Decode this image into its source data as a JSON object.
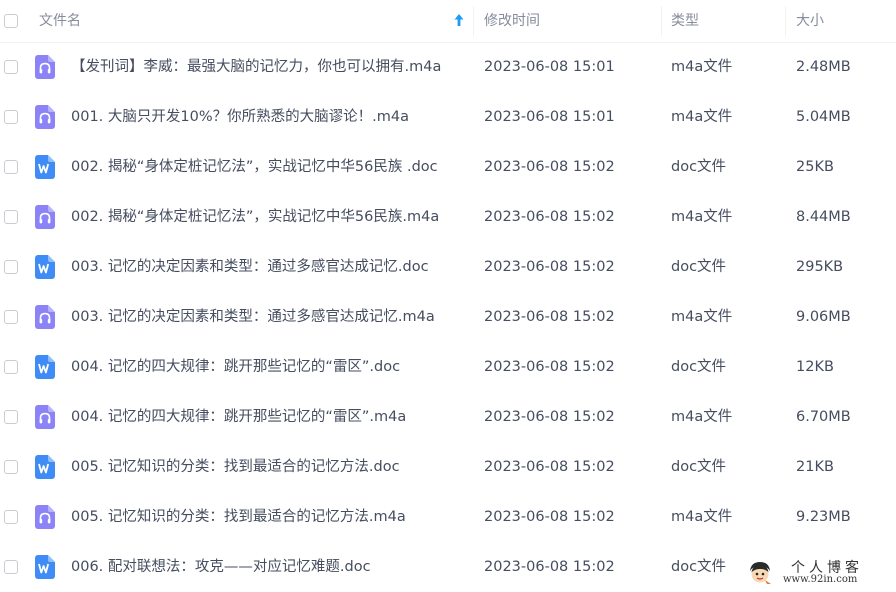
{
  "header": {
    "name_label": "文件名",
    "time_label": "修改时间",
    "type_label": "类型",
    "size_label": "大小"
  },
  "colors": {
    "audio_icon": "#8c83f6",
    "doc_icon": "#3f8cf6",
    "sort_arrow": "#1e9bf5"
  },
  "files": [
    {
      "name": "【发刊词】李威：最强大脑的记忆力，你也可以拥有.m4a",
      "time": "2023-06-08 15:01",
      "type": "m4a文件",
      "size": "2.48MB",
      "icon": "audio-file-icon"
    },
    {
      "name": "001. 大脑只开发10%？你所熟悉的大脑谬论！.m4a",
      "time": "2023-06-08 15:01",
      "type": "m4a文件",
      "size": "5.04MB",
      "icon": "audio-file-icon"
    },
    {
      "name": "002. 揭秘“身体定桩记忆法”，实战记忆中华56民族 .doc",
      "time": "2023-06-08 15:02",
      "type": "doc文件",
      "size": "25KB",
      "icon": "word-doc-icon"
    },
    {
      "name": "002. 揭秘“身体定桩记忆法”，实战记忆中华56民族.m4a",
      "time": "2023-06-08 15:02",
      "type": "m4a文件",
      "size": "8.44MB",
      "icon": "audio-file-icon"
    },
    {
      "name": "003. 记忆的决定因素和类型：通过多感官达成记忆.doc",
      "time": "2023-06-08 15:02",
      "type": "doc文件",
      "size": "295KB",
      "icon": "word-doc-icon"
    },
    {
      "name": "003. 记忆的决定因素和类型：通过多感官达成记忆.m4a",
      "time": "2023-06-08 15:02",
      "type": "m4a文件",
      "size": "9.06MB",
      "icon": "audio-file-icon"
    },
    {
      "name": "004. 记忆的四大规律：跳开那些记忆的“雷区”.doc",
      "time": "2023-06-08 15:02",
      "type": "doc文件",
      "size": "12KB",
      "icon": "word-doc-icon"
    },
    {
      "name": "004. 记忆的四大规律：跳开那些记忆的“雷区”.m4a",
      "time": "2023-06-08 15:02",
      "type": "m4a文件",
      "size": "6.70MB",
      "icon": "audio-file-icon"
    },
    {
      "name": "005. 记忆知识的分类：找到最适合的记忆方法.doc",
      "time": "2023-06-08 15:02",
      "type": "doc文件",
      "size": "21KB",
      "icon": "word-doc-icon"
    },
    {
      "name": "005. 记忆知识的分类：找到最适合的记忆方法.m4a",
      "time": "2023-06-08 15:02",
      "type": "m4a文件",
      "size": "9.23MB",
      "icon": "audio-file-icon"
    },
    {
      "name": "006. 配对联想法：攻克——对应记忆难题.doc",
      "time": "2023-06-08 15:02",
      "type": "doc文件",
      "size": "",
      "icon": "word-doc-icon"
    }
  ],
  "watermark": {
    "title": "个人博客",
    "url": "www.92in.com"
  }
}
